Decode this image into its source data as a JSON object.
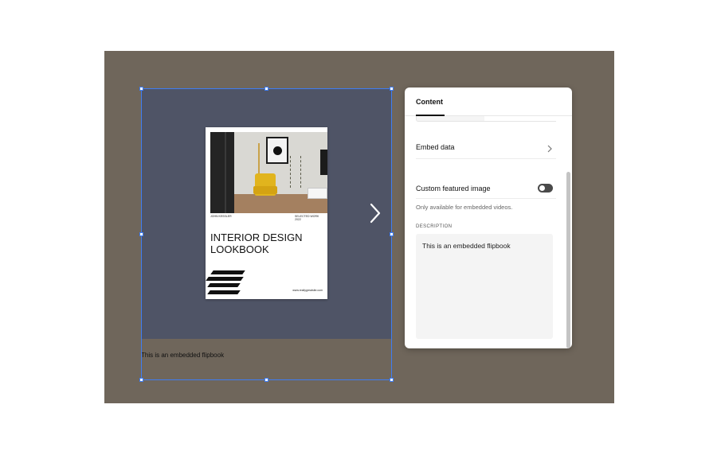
{
  "embed": {
    "caption": "This is an embedded flipbook",
    "book": {
      "author": "JOHN KESSLER",
      "collection": "SELECTED WORK 2022",
      "title_line1": "INTERIOR DESIGN",
      "title_line2": "LOOKBOOK",
      "url": "www.reallygreatsite.com"
    },
    "next_icon": "chevron-right-icon"
  },
  "panel": {
    "tab_label": "Content",
    "embed_data_label": "Embed data",
    "custom_image_label": "Custom featured image",
    "custom_image_enabled": false,
    "help_text": "Only available for embedded videos.",
    "description_label": "DESCRIPTION",
    "description_value": "This is an embedded flipbook"
  },
  "colors": {
    "canvas_bg": "#6f665b",
    "embed_bg": "#4f5466",
    "selection": "#3f7df3",
    "chair": "#e1b41d"
  }
}
